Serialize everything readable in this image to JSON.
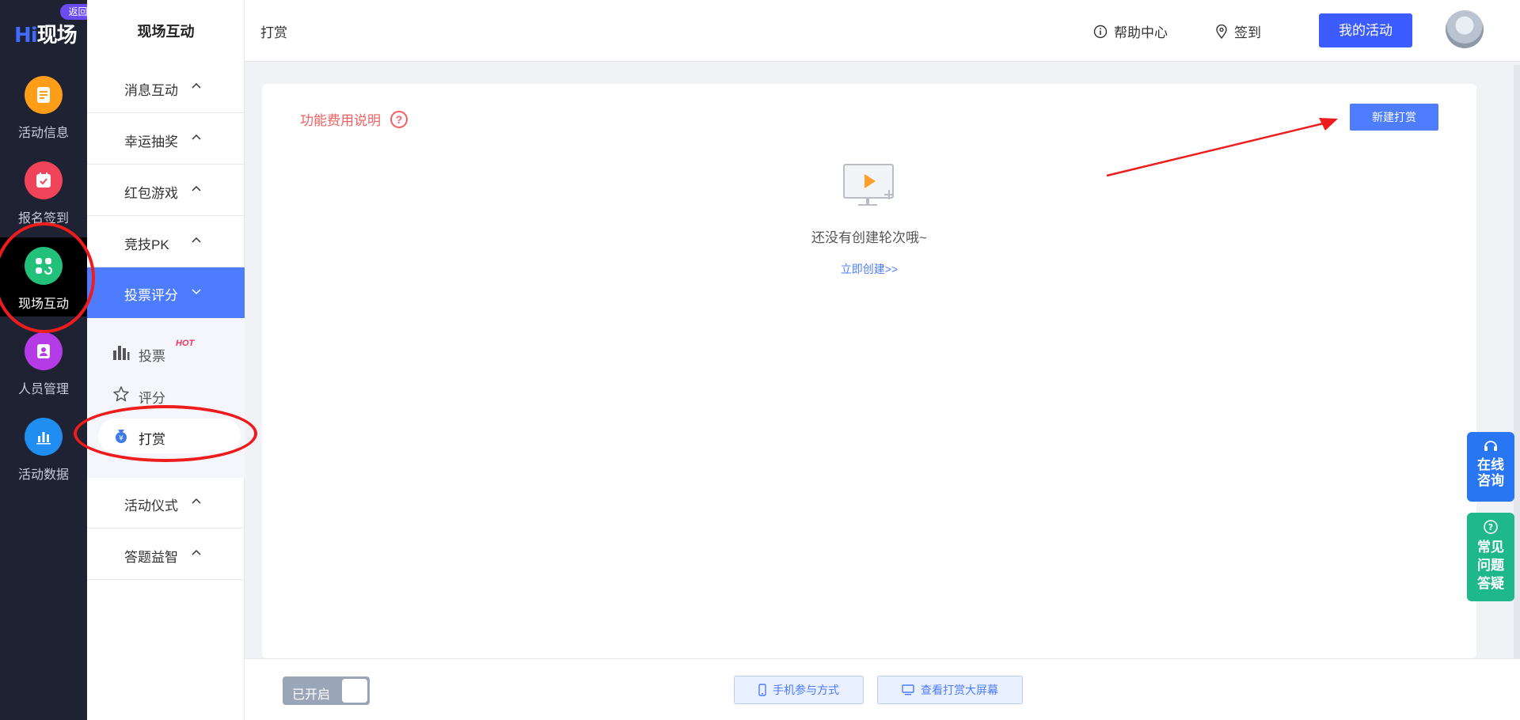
{
  "rail": {
    "back_badge": "返回",
    "items": [
      {
        "label": "活动信息",
        "icon": "document-icon",
        "color": "#ff9c18"
      },
      {
        "label": "报名签到",
        "icon": "calendar-check-icon",
        "color": "#f0445a"
      },
      {
        "label": "现场互动",
        "icon": "interaction-icon",
        "color": "#22c07a",
        "active": true
      },
      {
        "label": "人员管理",
        "icon": "person-card-icon",
        "color": "#b43be6"
      },
      {
        "label": "活动数据",
        "icon": "bar-chart-icon",
        "color": "#1f8ef0"
      }
    ]
  },
  "submenu": {
    "title": "现场互动",
    "groups": [
      {
        "label": "消息互动"
      },
      {
        "label": "幸运抽奖"
      },
      {
        "label": "红包游戏"
      },
      {
        "label": "竞技PK"
      },
      {
        "label": "投票评分",
        "active": true
      },
      {
        "label": "活动仪式"
      },
      {
        "label": "答题益智"
      }
    ],
    "sub_items": [
      {
        "label": "投票",
        "badge": "HOT",
        "icon": "bar-chart-icon"
      },
      {
        "label": "评分",
        "icon": "star-icon"
      },
      {
        "label": "打赏",
        "icon": "money-bag-icon",
        "selected": true
      }
    ]
  },
  "topbar": {
    "breadcrumb": "打赏",
    "help": "帮助中心",
    "checkin": "签到",
    "my_activity": "我的活动"
  },
  "main": {
    "fee_link": "功能费用说明",
    "new_button": "新建打赏",
    "empty_text": "还没有创建轮次哦~",
    "create_link": "立即创建>>"
  },
  "float": {
    "online": "在线\n咨询",
    "online_lines": [
      "在线",
      "咨询"
    ],
    "faq_lines": [
      "常见",
      "问题",
      "答疑"
    ]
  },
  "footer": {
    "toggle_label": "已开启",
    "toggle_on": true,
    "mobile_btn": "手机参与方式",
    "screen_btn": "查看打赏大屏幕"
  },
  "colors": {
    "accent": "#4d7cff",
    "rail_bg": "#1e2232",
    "annotation": "#ee1c1c"
  }
}
